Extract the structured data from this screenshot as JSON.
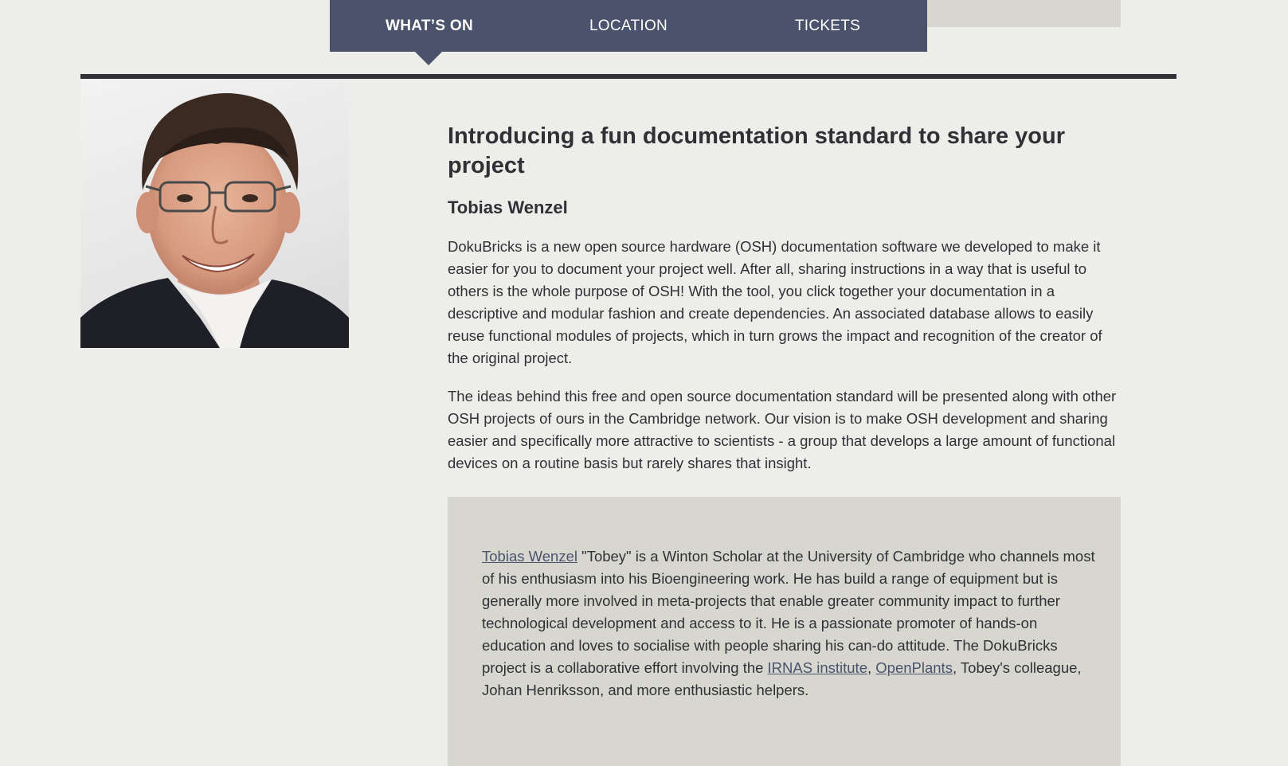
{
  "nav": {
    "items": [
      {
        "label": "WHAT’S ON",
        "active": true
      },
      {
        "label": "LOCATION",
        "active": false
      },
      {
        "label": "TICKETS",
        "active": false
      }
    ]
  },
  "colors": {
    "nav_bg": "#4a536b",
    "page_bg": "#ededea",
    "panel_bg": "#d7d7d0",
    "text": "#2f3136",
    "link": "#4a536b"
  },
  "speaker_photo": {
    "icon": "portrait-photo"
  },
  "article": {
    "title": "Introducing a fun documentation standard to share your project",
    "speaker_name": "Tobias Wenzel",
    "paragraph_1": "DokuBricks is a new open source hardware (OSH) documentation software we developed to make it easier for you to document your project well. After all, sharing instructions in a way that is useful to others is the whole purpose of OSH! With the tool, you click together your documentation in a descriptive and modular fashion and create dependencies. An associated database allows to easily reuse functional modules of projects, which in turn grows the impact and recognition of the creator of the original project.",
    "paragraph_2": "The ideas behind this free and open source documentation standard will be presented along with other OSH projects of ours in the Cambridge network. Our vision is to make OSH development and sharing easier and specifically more attractive to scientists - a group that develops a large amount of functional devices on a routine basis but rarely shares that insight."
  },
  "bio": {
    "link_name": "Tobias Wenzel",
    "text_1": " \"Tobey\" is a Winton Scholar at the University of Cambridge who channels most of his enthusiasm into his Bioengineering work. He has build a range of equipment but is generally more involved in meta-projects that enable greater community impact to further technological development and access to it. He is a passionate promoter of hands-on education and loves to socialise with people sharing his can-do attitude. The DokuBricks project is a collaborative effort involving the ",
    "link_irnas": "IRNAS institute",
    "text_2": ", ",
    "link_openplants": "OpenPlants",
    "text_3": ", Tobey's colleague, Johan Henriksson, and more enthusiastic helpers."
  }
}
